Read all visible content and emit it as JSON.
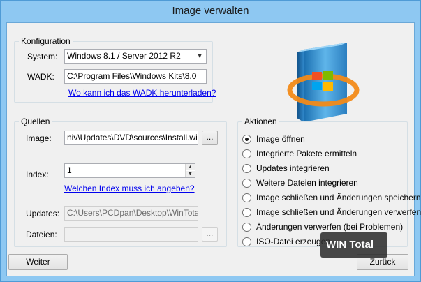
{
  "window": {
    "title": "Image verwalten"
  },
  "konfiguration": {
    "legend": "Konfiguration",
    "system_label": "System:",
    "system_value": "Windows 8.1 / Server 2012 R2",
    "wadk_label": "WADK:",
    "wadk_value": "C:\\Program Files\\Windows Kits\\8.0",
    "wadk_link": "Wo kann ich das WADK herunterladen?"
  },
  "quellen": {
    "legend": "Quellen",
    "image_label": "Image:",
    "image_value": "niv\\Updates\\DVD\\sources\\Install.wim",
    "browse_label": "...",
    "index_label": "Index:",
    "index_value": "1",
    "index_link": "Welchen Index muss ich angeben?",
    "updates_label": "Updates:",
    "updates_value": "C:\\Users\\PCDpan\\Desktop\\WinTotal",
    "dateien_label": "Dateien:",
    "dateien_value": "",
    "dateien_browse_label": "..."
  },
  "aktionen": {
    "legend": "Aktionen",
    "items": [
      {
        "label": "Image öffnen",
        "checked": true
      },
      {
        "label": "Integrierte Pakete ermitteln",
        "checked": false
      },
      {
        "label": "Updates integrieren",
        "checked": false
      },
      {
        "label": "Weitere Dateien integrieren",
        "checked": false
      },
      {
        "label": "Image schließen und Änderungen speichern",
        "checked": false
      },
      {
        "label": "Image schließen und Änderungen verwerfen",
        "checked": false
      },
      {
        "label": "Änderungen verwerfen (bei Problemen)",
        "checked": false
      },
      {
        "label": "ISO-Datei erzeugen",
        "checked": false
      }
    ]
  },
  "buttons": {
    "weiter": "Weiter",
    "zurueck": "Zurück"
  },
  "watermark": "WIN Total",
  "icons": {
    "product_box": "windows-product-box-icon"
  },
  "colors": {
    "title_bg": "#8ec8f2",
    "link": "#0000ee",
    "client_bg": "#f0f0f0"
  }
}
